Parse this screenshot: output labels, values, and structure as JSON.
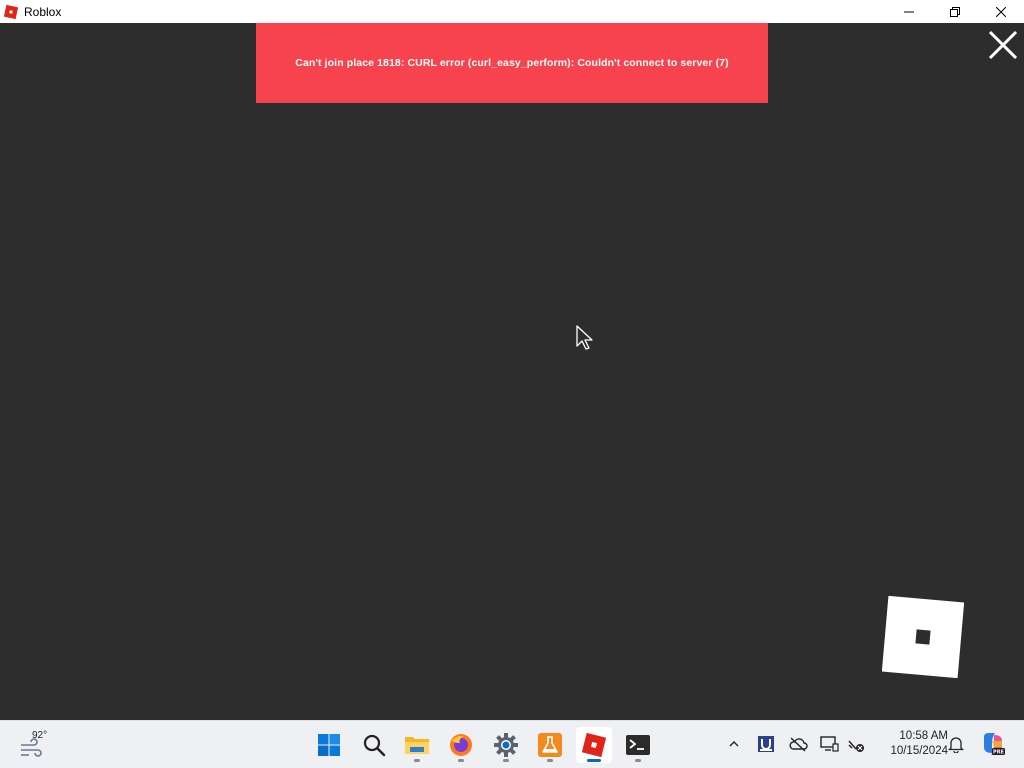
{
  "window": {
    "title": "Roblox",
    "controls": [
      "minimize",
      "restore",
      "close"
    ]
  },
  "game": {
    "error_message": "Can't join place 1818: CURL error (curl_easy_perform): Couldn't connect to server (7)",
    "close_icon": "close-icon",
    "logo": "roblox-logo"
  },
  "colors": {
    "error_bg": "#f7434d",
    "game_bg": "#2d2d2d",
    "roblox_red": "#e2231a"
  },
  "taskbar": {
    "weather": {
      "temp": "92°",
      "icon": "wind-icon"
    },
    "pinned": [
      {
        "name": "start",
        "icon": "windows-logo-icon"
      },
      {
        "name": "search",
        "icon": "search-icon"
      },
      {
        "name": "file-explorer",
        "icon": "folder-icon"
      },
      {
        "name": "firefox",
        "icon": "firefox-icon"
      },
      {
        "name": "settings",
        "icon": "gear-icon"
      },
      {
        "name": "lab",
        "icon": "flask-icon"
      },
      {
        "name": "roblox",
        "icon": "roblox-icon",
        "active": true
      },
      {
        "name": "terminal",
        "icon": "terminal-icon"
      }
    ],
    "tray": [
      "chevron-up-icon",
      "u-app-icon",
      "cloud-off-icon",
      "display-icon",
      "network-off-icon"
    ],
    "time": "10:58 AM",
    "date": "10/15/2024",
    "bell": "bell-icon",
    "copilot": "copilot-icon"
  }
}
